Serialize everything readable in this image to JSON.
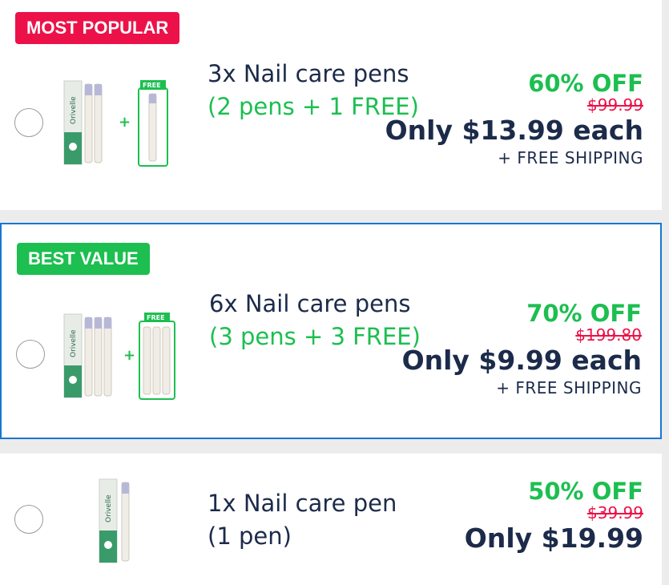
{
  "offers": [
    {
      "badge": "MOST POPULAR",
      "title": "3x Nail care pens",
      "subtitle": "(2 pens + 1 FREE)",
      "discount": "60% OFF",
      "old_price": "$99.99",
      "price_text": "Only $13.99 each",
      "shipping": "+ FREE SHIPPING",
      "free_tag": "FREE",
      "product_brand": "Orivelle"
    },
    {
      "badge": "BEST VALUE",
      "title": "6x Nail care pens",
      "subtitle": "(3 pens + 3 FREE)",
      "discount": "70% OFF",
      "old_price": "$199.80",
      "price_text": "Only $9.99 each",
      "shipping": "+ FREE SHIPPING",
      "free_tag": "FREE",
      "product_brand": "Orivelle"
    },
    {
      "title": "1x Nail care pen",
      "subtitle": "(1 pen)",
      "discount": "50% OFF",
      "old_price": "$39.99",
      "price_text": "Only $19.99",
      "product_brand": "Orivelle"
    }
  ],
  "colors": {
    "badge_red": "#ec1249",
    "badge_green": "#1cbf50",
    "selected_border": "#1976d2",
    "navy_text": "#1c2b4a"
  },
  "selected_offer_index": 1
}
